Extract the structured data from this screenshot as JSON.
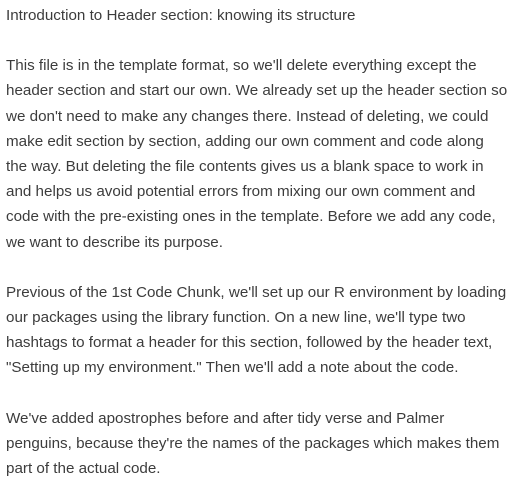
{
  "heading": "Introduction to Header section: knowing its structure",
  "paragraphs": [
    "This file is in the template format, so we'll delete everything except the header section and start our own. We already set up the header section so we don't need to make any changes there. Instead of deleting, we could make edit section by section, adding our own comment and code along the way. But deleting the file contents gives us a blank space to work in and helps us avoid potential errors from mixing our own comment and code with the pre-existing ones in the template. Before we add any code, we want to describe its purpose.",
    "Previous of the 1st Code Chunk, we'll set up our R environment by loading our packages using the library function. On a new line, we'll type two hashtags to format a header for this section, followed by the header text, \"Setting up my environment.\" Then we'll add a note about the code.",
    "We've added apostrophes before and after tidy verse and Palmer penguins, because they're the names of the packages which makes them part of the actual code."
  ]
}
